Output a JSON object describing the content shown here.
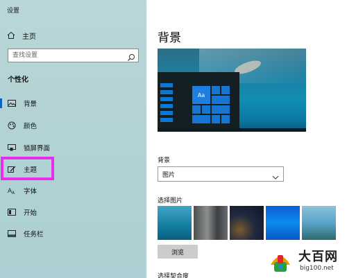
{
  "window": {
    "title": "设置"
  },
  "sidebar": {
    "home_label": "主页",
    "search_placeholder": "查找设置",
    "section_title": "个性化",
    "items": [
      {
        "label": "背景",
        "icon": "picture-icon",
        "selected": true
      },
      {
        "label": "颜色",
        "icon": "palette-icon"
      },
      {
        "label": "锁屏界面",
        "icon": "lock-screen-icon"
      },
      {
        "label": "主题",
        "icon": "theme-brush-icon",
        "highlighted": true
      },
      {
        "label": "字体",
        "icon": "font-icon"
      },
      {
        "label": "开始",
        "icon": "start-grid-icon"
      },
      {
        "label": "任务栏",
        "icon": "taskbar-icon"
      }
    ]
  },
  "main": {
    "title": "背景",
    "preview_tile_text": "Aa",
    "background_label": "背景",
    "background_value": "图片",
    "choose_picture_label": "选择图片",
    "browse_label": "浏览",
    "choose_fit_label": "选择契合度"
  },
  "watermark": {
    "brand": "大百网",
    "url": "big100.net"
  },
  "colors": {
    "accent": "#0a63c4",
    "highlight": "#e92de8"
  }
}
